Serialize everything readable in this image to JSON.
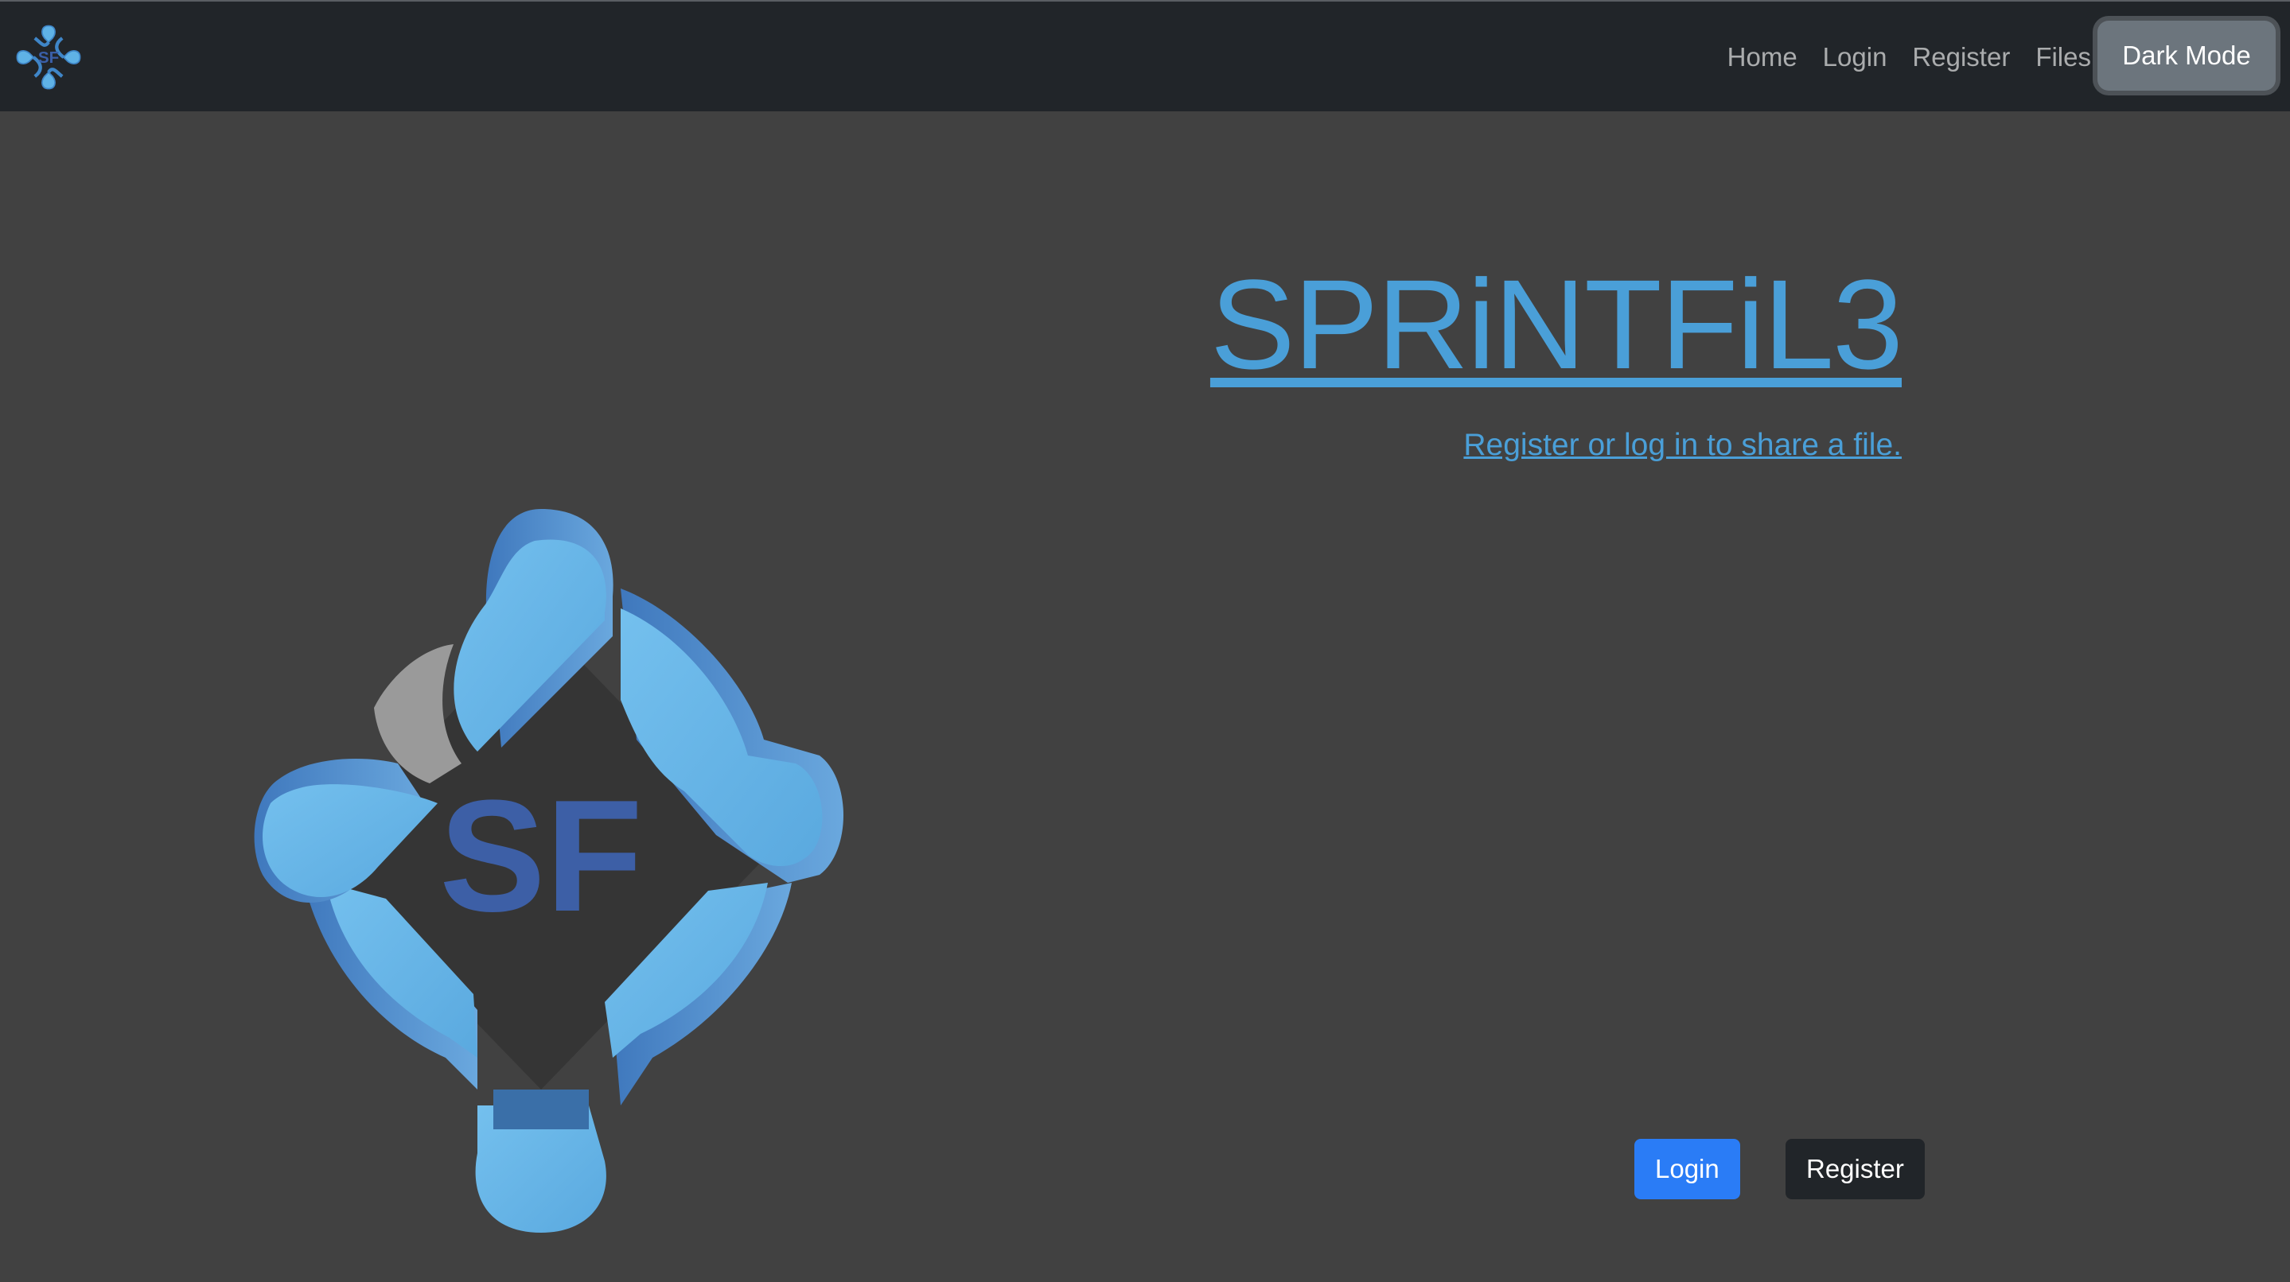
{
  "navbar": {
    "logo_icon": "sprintfile-logo-icon",
    "links": [
      {
        "label": "Home"
      },
      {
        "label": "Login"
      },
      {
        "label": "Register"
      },
      {
        "label": "Files"
      }
    ],
    "dark_mode_label": "Dark Mode"
  },
  "hero": {
    "logo_text": "SF",
    "title": "SPRiNTFiL3",
    "tagline": "Register or log in to share a file.",
    "login_label": "Login",
    "register_label": "Register"
  },
  "colors": {
    "navbar_bg": "#212529",
    "page_bg": "#414141",
    "accent": "#4a9fd8",
    "primary_button": "#2a7cf6",
    "dark_button": "#212529",
    "secondary_button": "#6c757d"
  }
}
